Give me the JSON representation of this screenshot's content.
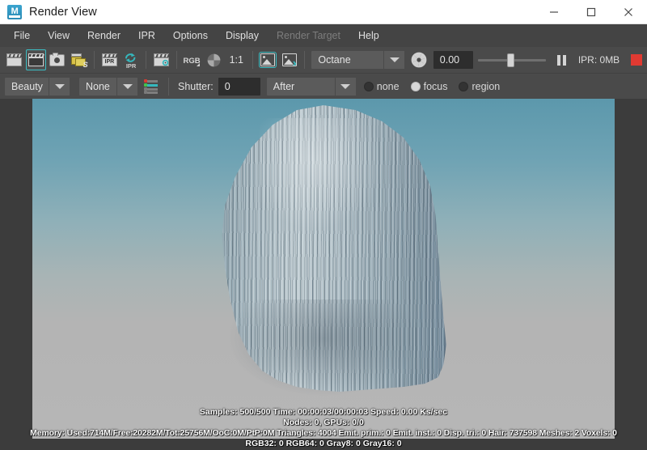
{
  "window": {
    "title": "Render View",
    "app_icon": "maya-logo-icon",
    "minimize_label": "Minimize",
    "maximize_label": "Maximize",
    "close_label": "Close"
  },
  "menubar": {
    "items": [
      {
        "label": "File",
        "disabled": false
      },
      {
        "label": "View",
        "disabled": false
      },
      {
        "label": "Render",
        "disabled": false
      },
      {
        "label": "IPR",
        "disabled": false
      },
      {
        "label": "Options",
        "disabled": false
      },
      {
        "label": "Display",
        "disabled": false
      },
      {
        "label": "Render Target",
        "disabled": true
      },
      {
        "label": "Help",
        "disabled": false
      }
    ]
  },
  "toolbar": {
    "render_region_label": "",
    "ipr_text": "IPR",
    "rgb_label": "RGB",
    "ratio_label": "1:1",
    "s_label": "S",
    "renderer": "Octane",
    "exposure_value": "0.00",
    "ipr_memory": "IPR: 0MB",
    "icons": [
      "render-clapper-icon",
      "render-region-clapper-icon",
      "snapshot-camera-icon",
      "render-sequence-icon",
      "ipr-render-icon",
      "ipr-refresh-icon",
      "render-settings-icon",
      "rgb-channel-icon",
      "alpha-channel-icon",
      "zoom-1to1-icon",
      "keep-image-icon",
      "remove-image-icon",
      "aperture-icon",
      "pause-icon",
      "stop-icon"
    ]
  },
  "toolbar2": {
    "pass_value": "Beauty",
    "aov_value": "None",
    "channel_icon": "channel-list-icon",
    "shutter_label": "Shutter:",
    "shutter_value": "0",
    "shutter_mode": "After",
    "picker_modes": [
      {
        "label": "none",
        "selected": false
      },
      {
        "label": "focus",
        "selected": true
      },
      {
        "label": "region",
        "selected": false
      }
    ]
  },
  "render": {
    "alt": "Rendered long-haired character over teal to gray gradient background"
  },
  "stats": {
    "line1": "Samples: 500/500 Time: 00:00:03/00:00:03 Speed: 0.00 Ks/sec",
    "line2": "Nodes: 0, GPUs: 0/0",
    "line3": "Memory: Used:714M/Free:20282M/Tot:25756M/OoC:0M/PtP:0M Triangles: 4004 Emit. prim.: 0 Emit. inst.: 0 Disp. tri.: 0 Hair: 737598 Meshes: 2 Voxels: 0",
    "line4": "RGB32: 0 RGB64: 0 Gray8: 0 Gray16: 0"
  },
  "colors": {
    "titlebar_bg": "#ffffff",
    "menubar_bg": "#444444",
    "toolbar_bg": "#4a4a4a",
    "app_bg": "#3c3c3c",
    "accent_teal": "#3bbec4",
    "stop_red": "#e03a32",
    "text_light": "#e0e0e0",
    "text_disabled": "#7d7d7d"
  }
}
